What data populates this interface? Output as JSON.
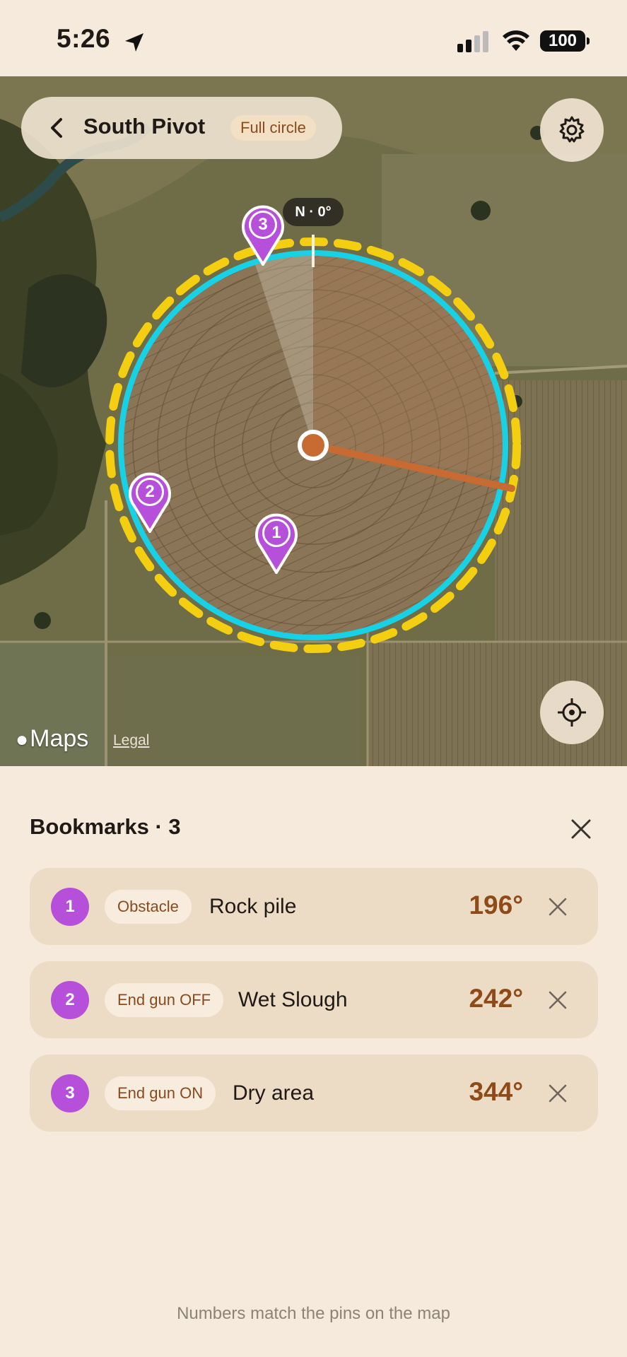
{
  "status": {
    "time": "5:26",
    "battery": "100"
  },
  "map": {
    "title": "South Pivot",
    "mode": "Full circle",
    "north_label": "N · 0°",
    "attribution": "Maps",
    "legal": "Legal",
    "pins": [
      {
        "number": "1"
      },
      {
        "number": "2"
      },
      {
        "number": "3"
      }
    ],
    "colors": {
      "boundary": "#17d1e6",
      "end_gun_ring": "#f4cf11",
      "arm": "#c76b33",
      "pin": "#b64fd9"
    }
  },
  "bookmarks": {
    "title": "Bookmarks · 3",
    "items": [
      {
        "number": "1",
        "tag": "Obstacle",
        "name": "Rock pile",
        "angle": "196°"
      },
      {
        "number": "2",
        "tag": "End gun OFF",
        "name": "Wet Slough",
        "angle": "242°"
      },
      {
        "number": "3",
        "tag": "End gun ON",
        "name": "Dry area",
        "angle": "344°"
      }
    ],
    "footnote": "Numbers match the pins on the map"
  }
}
